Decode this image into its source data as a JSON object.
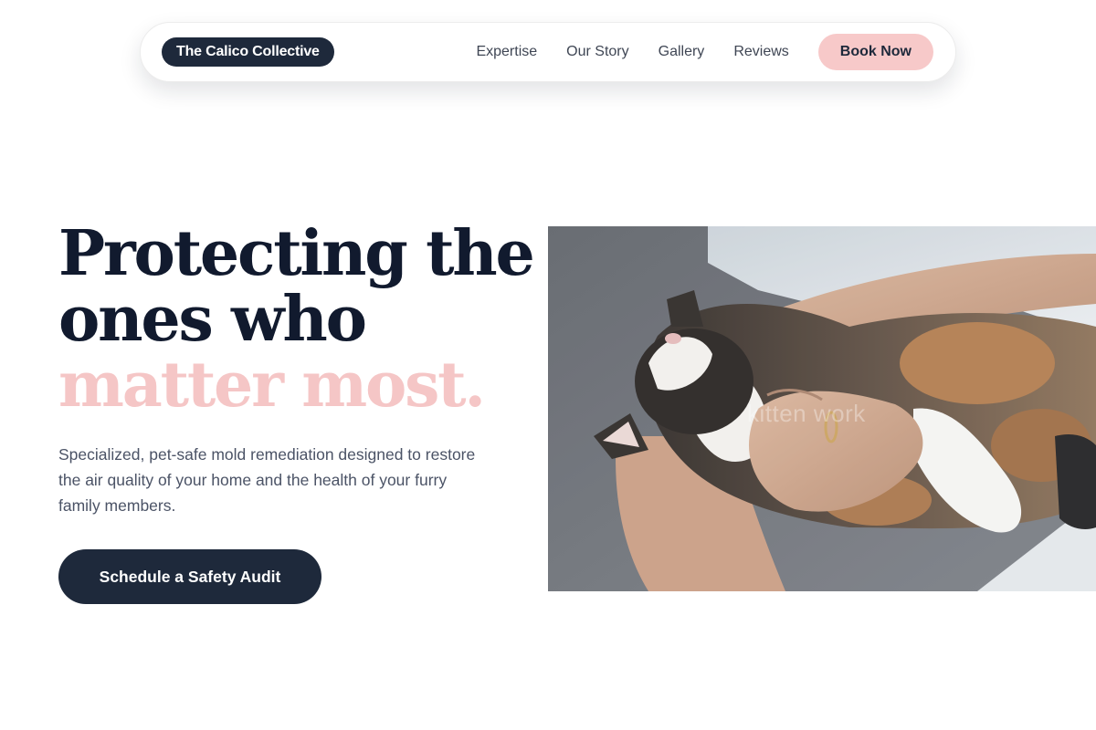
{
  "nav": {
    "brand": "The Calico Collective",
    "links": [
      "Expertise",
      "Our Story",
      "Gallery",
      "Reviews"
    ],
    "cta": "Book Now"
  },
  "hero": {
    "headline_line1": "Protecting the",
    "headline_line2": "ones who",
    "headline_accent": "matter most.",
    "subtext": "Specialized, pet-safe mold remediation designed to restore the air quality of your home and the health of your furry family members.",
    "cta": "Schedule a Safety Audit",
    "image_watermark": "kitten work"
  },
  "colors": {
    "navy": "#1e293b",
    "headline": "#111a2e",
    "accent_pink": "#f5c6c6",
    "button_pink": "#f7c9c9",
    "body_text": "#4b5366"
  }
}
